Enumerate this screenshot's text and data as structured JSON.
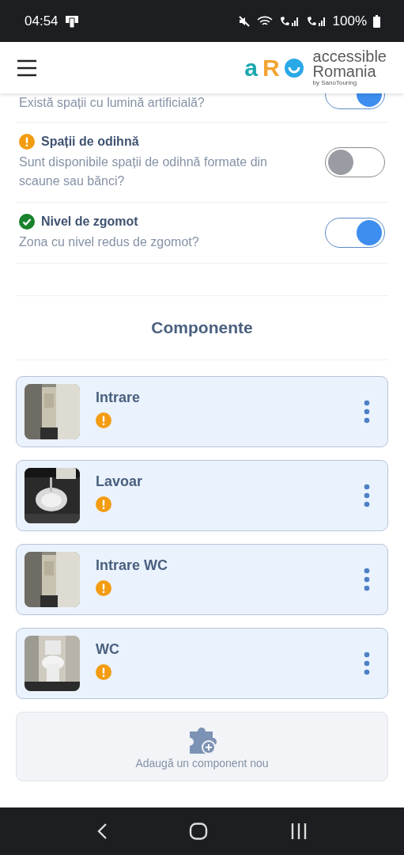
{
  "status_bar": {
    "time": "04:54",
    "battery": "100%"
  },
  "header": {
    "logo_letters": [
      "a",
      "R"
    ],
    "logo_title": "accessible",
    "logo_title_2": "Romania",
    "logo_byline": "by SanoTouring"
  },
  "features": [
    {
      "description": "Există spații cu lumină artificială?",
      "on": true
    },
    {
      "kind": "warning",
      "title": "Spații de odihnă",
      "description": "Sunt disponibile spații de odihnă formate din scaune sau bănci?",
      "on": false
    },
    {
      "kind": "ok",
      "title": "Nivel de zgomot",
      "description": "Zona cu nivel redus de zgomot?",
      "on": true
    }
  ],
  "section_title": "Componente",
  "components": [
    {
      "name": "Intrare",
      "kind": "warning"
    },
    {
      "name": "Lavoar",
      "kind": "warning"
    },
    {
      "name": "Intrare WC",
      "kind": "warning"
    },
    {
      "name": "WC",
      "kind": "warning"
    }
  ],
  "add_button": "Adaugă un component nou"
}
